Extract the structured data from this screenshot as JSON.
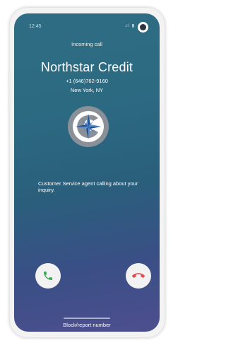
{
  "status_bar": {
    "time": "12:45",
    "icons": "signal-icon battery-icon",
    "signal_glyph": ".ıl",
    "battery_glyph": "▮"
  },
  "call": {
    "status": "Incoming call",
    "caller_name": "Northstar Credit",
    "phone_number": "+1 (646)762-9160",
    "location": "New York, NY",
    "message": "Customer Service agent calling about your inquiry."
  },
  "actions": {
    "answer_icon": "phone-icon",
    "decline_icon": "phone-hangup-icon",
    "block_label": "Block/report number"
  },
  "colors": {
    "answer": "#3aa655",
    "decline": "#e2454a",
    "logo_ring": "#8a9098",
    "logo_star": "#1f4f8a"
  }
}
